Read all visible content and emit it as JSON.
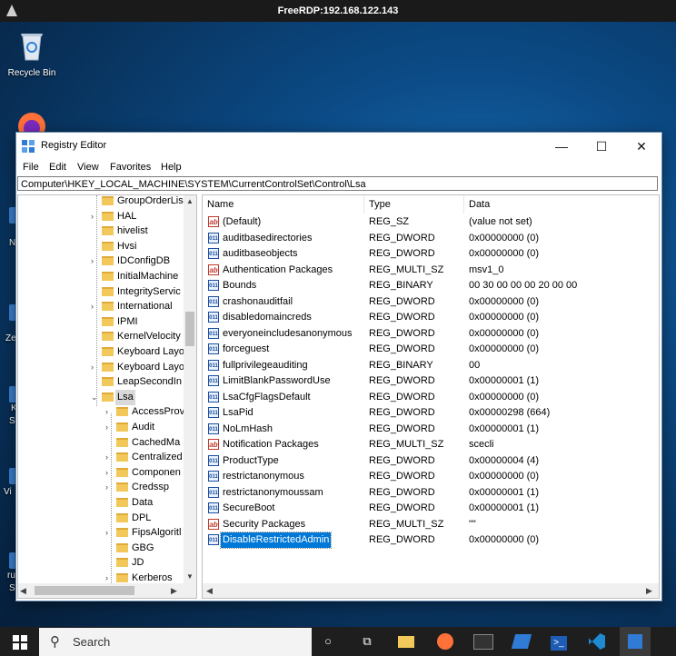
{
  "rdp": {
    "title": "FreeRDP:192.168.122.143"
  },
  "desktop": {
    "recycle_bin_label": "Recycle Bin",
    "left_labels": [
      "N",
      "Ze",
      "K",
      "S",
      "Vi",
      "ru",
      "S"
    ]
  },
  "window": {
    "title": "Registry Editor",
    "minimize": "—",
    "maximize": "☐",
    "close": "✕"
  },
  "menu": [
    "File",
    "Edit",
    "View",
    "Favorites",
    "Help"
  ],
  "address": "Computer\\HKEY_LOCAL_MACHINE\\SYSTEM\\CurrentControlSet\\Control\\Lsa",
  "tree": {
    "nodes": [
      {
        "label": "GroupOrderLis",
        "exp": ""
      },
      {
        "label": "HAL",
        "exp": "›"
      },
      {
        "label": "hivelist",
        "exp": ""
      },
      {
        "label": "Hvsi",
        "exp": ""
      },
      {
        "label": "IDConfigDB",
        "exp": "›"
      },
      {
        "label": "InitialMachine",
        "exp": ""
      },
      {
        "label": "IntegrityServic",
        "exp": ""
      },
      {
        "label": "International",
        "exp": "›"
      },
      {
        "label": "IPMI",
        "exp": ""
      },
      {
        "label": "KernelVelocity",
        "exp": ""
      },
      {
        "label": "Keyboard Layo",
        "exp": ""
      },
      {
        "label": "Keyboard Layo",
        "exp": "›"
      },
      {
        "label": "LeapSecondIn",
        "exp": ""
      },
      {
        "label": "Lsa",
        "exp": "⌄"
      },
      {
        "label": "AccessProv",
        "exp": "›"
      },
      {
        "label": "Audit",
        "exp": "›"
      },
      {
        "label": "CachedMa",
        "exp": ""
      },
      {
        "label": "Centralized",
        "exp": "›"
      },
      {
        "label": "Componen",
        "exp": "›"
      },
      {
        "label": "Credssp",
        "exp": "›"
      },
      {
        "label": "Data",
        "exp": ""
      },
      {
        "label": "DPL",
        "exp": ""
      },
      {
        "label": "FipsAlgoritl",
        "exp": "›"
      },
      {
        "label": "GBG",
        "exp": ""
      },
      {
        "label": "JD",
        "exp": ""
      },
      {
        "label": "Kerberos",
        "exp": "›"
      }
    ]
  },
  "list": {
    "headers": {
      "name": "Name",
      "type": "Type",
      "data": "Data"
    },
    "rows": [
      {
        "icon": "string-value-icon",
        "glyph": "ab",
        "name": "(Default)",
        "type": "REG_SZ",
        "data": "(value not set)"
      },
      {
        "icon": "binary-value-icon",
        "glyph": "011",
        "name": "auditbasedirectories",
        "type": "REG_DWORD",
        "data": "0x00000000 (0)"
      },
      {
        "icon": "binary-value-icon",
        "glyph": "011",
        "name": "auditbaseobjects",
        "type": "REG_DWORD",
        "data": "0x00000000 (0)"
      },
      {
        "icon": "string-value-icon",
        "glyph": "ab",
        "name": "Authentication Packages",
        "type": "REG_MULTI_SZ",
        "data": "msv1_0"
      },
      {
        "icon": "binary-value-icon",
        "glyph": "011",
        "name": "Bounds",
        "type": "REG_BINARY",
        "data": "00 30 00 00 00 20 00 00"
      },
      {
        "icon": "binary-value-icon",
        "glyph": "011",
        "name": "crashonauditfail",
        "type": "REG_DWORD",
        "data": "0x00000000 (0)"
      },
      {
        "icon": "binary-value-icon",
        "glyph": "011",
        "name": "disabledomaincreds",
        "type": "REG_DWORD",
        "data": "0x00000000 (0)"
      },
      {
        "icon": "binary-value-icon",
        "glyph": "011",
        "name": "everyoneincludesanonymous",
        "type": "REG_DWORD",
        "data": "0x00000000 (0)"
      },
      {
        "icon": "binary-value-icon",
        "glyph": "011",
        "name": "forceguest",
        "type": "REG_DWORD",
        "data": "0x00000000 (0)"
      },
      {
        "icon": "binary-value-icon",
        "glyph": "011",
        "name": "fullprivilegeauditing",
        "type": "REG_BINARY",
        "data": "00"
      },
      {
        "icon": "binary-value-icon",
        "glyph": "011",
        "name": "LimitBlankPasswordUse",
        "type": "REG_DWORD",
        "data": "0x00000001 (1)"
      },
      {
        "icon": "binary-value-icon",
        "glyph": "011",
        "name": "LsaCfgFlagsDefault",
        "type": "REG_DWORD",
        "data": "0x00000000 (0)"
      },
      {
        "icon": "binary-value-icon",
        "glyph": "011",
        "name": "LsaPid",
        "type": "REG_DWORD",
        "data": "0x00000298 (664)"
      },
      {
        "icon": "binary-value-icon",
        "glyph": "011",
        "name": "NoLmHash",
        "type": "REG_DWORD",
        "data": "0x00000001 (1)"
      },
      {
        "icon": "string-value-icon",
        "glyph": "ab",
        "name": "Notification Packages",
        "type": "REG_MULTI_SZ",
        "data": "scecli"
      },
      {
        "icon": "binary-value-icon",
        "glyph": "011",
        "name": "ProductType",
        "type": "REG_DWORD",
        "data": "0x00000004 (4)"
      },
      {
        "icon": "binary-value-icon",
        "glyph": "011",
        "name": "restrictanonymous",
        "type": "REG_DWORD",
        "data": "0x00000000 (0)"
      },
      {
        "icon": "binary-value-icon",
        "glyph": "011",
        "name": "restrictanonymoussam",
        "type": "REG_DWORD",
        "data": "0x00000001 (1)"
      },
      {
        "icon": "binary-value-icon",
        "glyph": "011",
        "name": "SecureBoot",
        "type": "REG_DWORD",
        "data": "0x00000001 (1)"
      },
      {
        "icon": "string-value-icon",
        "glyph": "ab",
        "name": "Security Packages",
        "type": "REG_MULTI_SZ",
        "data": "\"\""
      },
      {
        "icon": "binary-value-icon",
        "glyph": "011",
        "name": "DisableRestrictedAdmin",
        "type": "REG_DWORD",
        "data": "0x00000000 (0)",
        "selected": true
      }
    ]
  },
  "taskbar": {
    "search_placeholder": "Search",
    "icons": [
      "search-circle-icon",
      "task-view-icon",
      "file-explorer-icon",
      "firefox-icon",
      "terminal-icon",
      "app-icon",
      "powershell-icon",
      "vscode-icon",
      "registry-editor-icon"
    ]
  },
  "colors": {
    "selection": "#0078d7",
    "desktop": "#0b4a85",
    "taskbar": "#1e1e1e"
  }
}
